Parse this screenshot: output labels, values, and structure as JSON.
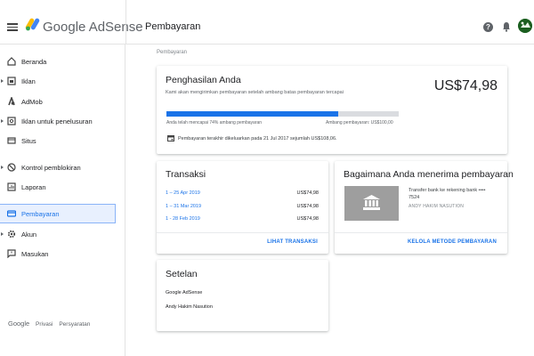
{
  "header": {
    "brand": "Google AdSense",
    "page_title": "Pembayaran"
  },
  "sidebar": {
    "items": [
      {
        "label": "Beranda"
      },
      {
        "label": "Iklan"
      },
      {
        "label": "AdMob"
      },
      {
        "label": "Iklan untuk penelusuran"
      },
      {
        "label": "Situs"
      },
      {
        "label": "Kontrol pemblokiran"
      },
      {
        "label": "Laporan"
      },
      {
        "label": "Pembayaran"
      },
      {
        "label": "Akun"
      },
      {
        "label": "Masukan"
      }
    ],
    "footer": {
      "google": "Google",
      "privacy": "Privasi",
      "terms": "Persyaratan"
    }
  },
  "breadcrumb": "Pembayaran",
  "earnings": {
    "title": "Penghasilan Anda",
    "subtitle": "Kami akan mengirimkan pembayaran setelah ambang batas pembayaran tercapai",
    "amount": "US$74,98",
    "progress_fraction": 0.74,
    "progress_left": "Anda telah mencapai 74% ambang pembayaran",
    "progress_right": "Ambang pembayaran: US$100,00",
    "last_payment": "Pembayaran terakhir dikeluarkan pada 21 Jul 2017 sejumlah US$108,06."
  },
  "transactions": {
    "title": "Transaksi",
    "rows": [
      {
        "date": "1 – 25 Apr 2019",
        "amount": "US$74,98"
      },
      {
        "date": "1 – 31 Mar 2019",
        "amount": "US$74,98"
      },
      {
        "date": "1 - 28 Feb 2019",
        "amount": "US$74,98"
      }
    ],
    "action": "LIHAT TRANSAKSI"
  },
  "payment_method": {
    "title": "Bagaimana Anda menerima pembayaran",
    "method_line1": "Transfer bank ke rekening bank ••••",
    "method_line2": "7524",
    "holder": "ANDY HAKIM NASUTION",
    "action": "KELOLA METODE PEMBAYARAN"
  },
  "settings": {
    "title": "Setelan",
    "line1": "Google AdSense",
    "line2": "Andy Hakim Nasution"
  },
  "colors": {
    "accent": "#1a73e8",
    "progress_track": "#dadce0",
    "bank_tile": "#9e9e9e"
  },
  "icons": [
    "menu-icon",
    "adsense-logo-icon",
    "help-icon",
    "bell-icon",
    "avatar",
    "home-icon",
    "ads-icon",
    "admob-icon",
    "search-ads-icon",
    "sites-icon",
    "block-icon",
    "reports-icon",
    "payments-icon",
    "gear-icon",
    "feedback-icon",
    "calendar-icon",
    "bank-icon"
  ]
}
